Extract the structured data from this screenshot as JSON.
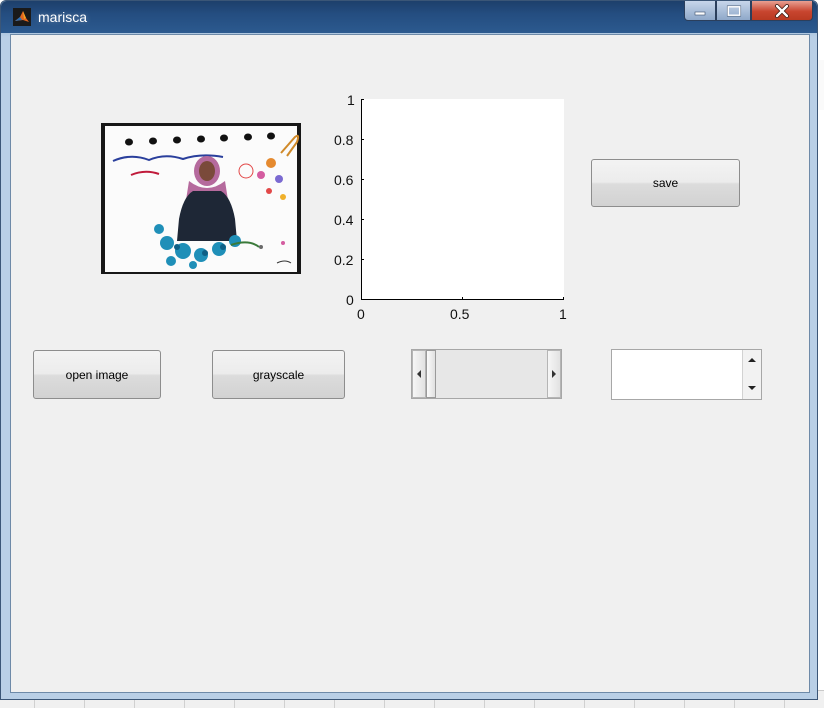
{
  "window": {
    "title": "marisca",
    "minimize_label": "—",
    "maximize_label": "□",
    "close_label": "✕"
  },
  "icons": {
    "app": "matlab-logo-icon",
    "minimize": "minimize-icon",
    "maximize": "maximize-icon",
    "close": "close-icon",
    "slider_left": "chevron-left-icon",
    "slider_right": "chevron-right-icon",
    "list_up": "arrow-up-icon",
    "list_down": "arrow-down-icon"
  },
  "image_panel": {
    "content": "portrait-photo-with-floral-frame"
  },
  "axes": {
    "y_ticks": [
      "0",
      "0.2",
      "0.4",
      "0.6",
      "0.8",
      "1"
    ],
    "x_ticks": [
      "0",
      "0.5",
      "1"
    ]
  },
  "buttons": {
    "save": "save",
    "open_image": "open image",
    "grayscale": "grayscale"
  },
  "slider": {
    "value": 0.0
  },
  "listbox": {
    "items": []
  },
  "colors": {
    "title_bar": "#244d80",
    "client_bg": "#f0f0f0",
    "close_button": "#c8452f"
  }
}
